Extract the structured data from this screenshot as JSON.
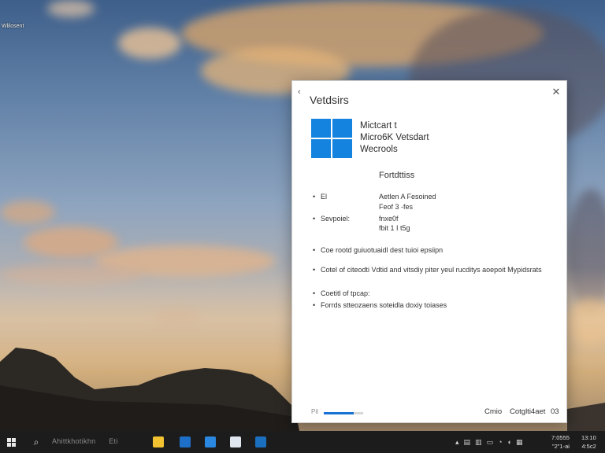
{
  "desktop": {
    "icon_label": "Wlilosent"
  },
  "dialog": {
    "back_glyph": "‹",
    "title": "Vetdsirs",
    "close_glyph": "✕",
    "product_lines": [
      "Mictcart t",
      "Micro6K Vetsdart",
      "Wecrools"
    ],
    "section_title": "Fortdttiss",
    "kv_rows": [
      {
        "bullet": "•",
        "key": "El",
        "value": "Aetlen A Fesoined",
        "sub": "Feof 3 -fes"
      },
      {
        "bullet": "•",
        "key": "Sevpoiel:",
        "value": "fnxe0f",
        "sub": "fbit 1 I t5g"
      }
    ],
    "notes": [
      {
        "bullet": "•",
        "text": "Coe rootd guiuotuaidl dest tuioi epsiipn"
      },
      {
        "bullet": "•",
        "text": "Cotel of citeodti Vdtid and vitsdiy piter yeul rucditys aoepoit Mypidsrats"
      },
      {
        "bullet": "•",
        "text": "Coetitl of tpcap:"
      },
      {
        "bullet": "•",
        "text": "Forrds stteozaens soteidla doxiy toiases"
      }
    ],
    "progress_fraction": 0.75,
    "footer_left": "Pil",
    "buttons": {
      "primary": "Cmio",
      "secondary": "Cotglti4aet",
      "third": "03"
    }
  },
  "taskbar": {
    "search_text": "Ahittkhotikhn",
    "search_extra": "Eti",
    "tray_icons": [
      "chevron-up-icon",
      "network-icon",
      "speaker-icon",
      "battery-icon",
      "wifi-icon",
      "volume-icon",
      "notification-icon"
    ],
    "clock_time": "7:0555",
    "clock_date": "\"2\"1-ai",
    "clock_time2": "13:10",
    "clock_date2": "4:5c2"
  },
  "colors": {
    "accent": "#1483e0",
    "taskbar": "#1c1c1c",
    "dialog_bg": "#ffffff"
  }
}
